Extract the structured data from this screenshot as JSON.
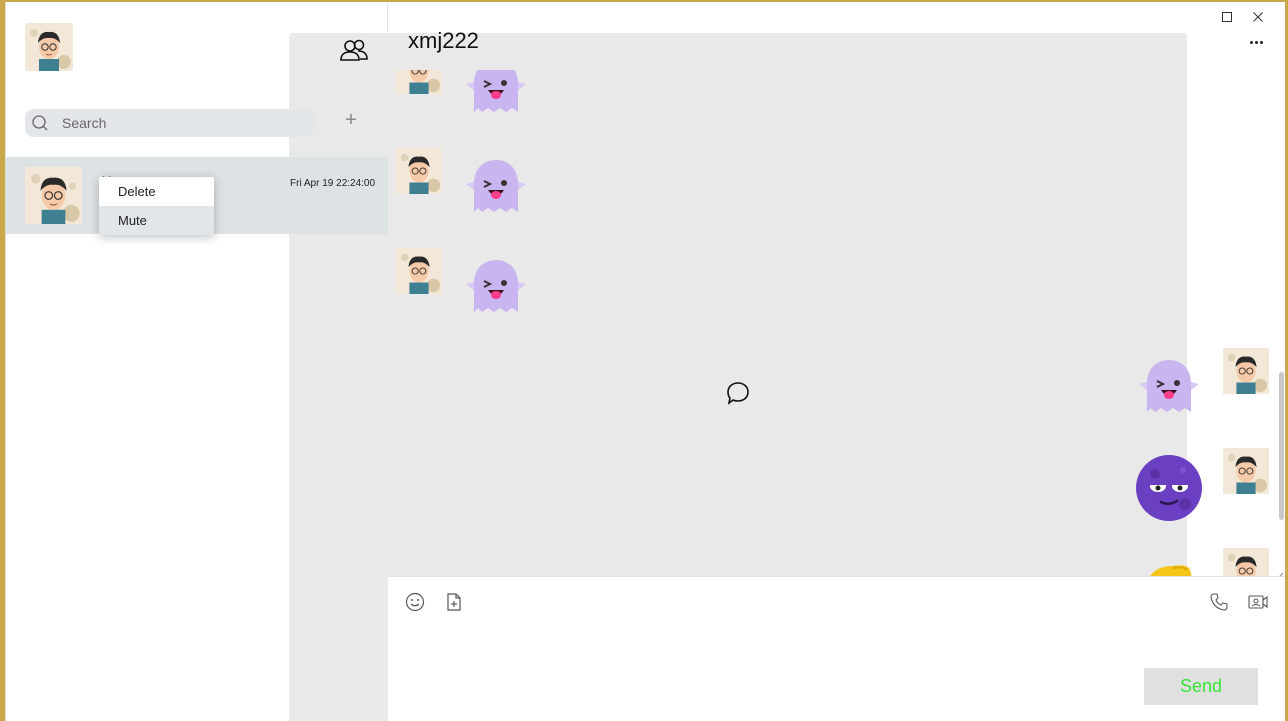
{
  "sidebar": {
    "search": {
      "placeholder": "Search"
    },
    "add_label": "+",
    "conversation": {
      "name": "X...",
      "time": "Fri Apr 19 22:24:00"
    },
    "context_menu": {
      "items": [
        "Delete",
        "Mute"
      ],
      "highlighted": "Mute"
    }
  },
  "chat": {
    "title": "xmj222",
    "messages": [
      {
        "side": "left",
        "sticker": "ghost-wink-sticker"
      },
      {
        "side": "left",
        "sticker": "ghost-wink-sticker"
      },
      {
        "side": "left",
        "sticker": "ghost-wink-sticker"
      },
      {
        "side": "right",
        "sticker": "ghost-wink-sticker"
      },
      {
        "side": "right",
        "sticker": "purple-moon-face-sticker"
      },
      {
        "side": "right",
        "sticker": "yellow-sticker"
      }
    ],
    "send_label": "Send"
  },
  "colors": {
    "accent_send_text": "#36e636",
    "selected_conversation": "#dde2e5",
    "ghost": "#c9b5f0",
    "moon": "#6a3fc2"
  }
}
